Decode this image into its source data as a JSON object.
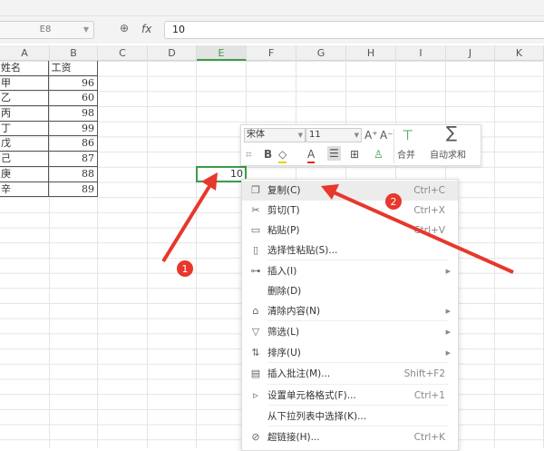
{
  "formula_bar": {
    "name_box": "E8",
    "fx_label": "fx",
    "value": "10"
  },
  "columns": [
    "A",
    "B",
    "C",
    "D",
    "E",
    "F",
    "G",
    "H",
    "I",
    "J",
    "K"
  ],
  "selected_column": "E",
  "table": {
    "headers": [
      "姓名",
      "工资"
    ],
    "rows": [
      [
        "甲",
        "96"
      ],
      [
        "乙",
        "60"
      ],
      [
        "丙",
        "98"
      ],
      [
        "丁",
        "99"
      ],
      [
        "戊",
        "86"
      ],
      [
        "己",
        "87"
      ],
      [
        "庚",
        "88"
      ],
      [
        "辛",
        "89"
      ]
    ]
  },
  "active_cell_value": "10",
  "mini_toolbar": {
    "font": "宋体",
    "size": "11",
    "bold": "B",
    "font_color": "A",
    "merge": "合并",
    "autosum": "自动求和"
  },
  "context_menu": [
    {
      "label": "复制(C)",
      "shortcut": "Ctrl+C",
      "icon": "copy-icon"
    },
    {
      "label": "剪切(T)",
      "shortcut": "Ctrl+X",
      "icon": "scissors-icon"
    },
    {
      "label": "粘贴(P)",
      "shortcut": "Ctrl+V",
      "icon": "paste-icon"
    },
    {
      "label": "选择性粘贴(S)...",
      "shortcut": "",
      "icon": "paste-special-icon"
    },
    {
      "label": "插入(I)",
      "shortcut": "",
      "icon": "insert-icon"
    },
    {
      "label": "删除(D)",
      "shortcut": "",
      "icon": ""
    },
    {
      "label": "清除内容(N)",
      "shortcut": "",
      "icon": "eraser-icon"
    },
    {
      "label": "筛选(L)",
      "shortcut": "",
      "icon": "filter-icon"
    },
    {
      "label": "排序(U)",
      "shortcut": "",
      "icon": "sort-icon"
    },
    {
      "label": "插入批注(M)...",
      "shortcut": "Shift+F2",
      "icon": "comment-icon"
    },
    {
      "label": "设置单元格格式(F)...",
      "shortcut": "Ctrl+1",
      "icon": "format-cells-icon"
    },
    {
      "label": "从下拉列表中选择(K)...",
      "shortcut": "",
      "icon": ""
    },
    {
      "label": "超链接(H)...",
      "shortcut": "Ctrl+K",
      "icon": "link-icon"
    }
  ],
  "annotations": {
    "step1": "1",
    "step2": "2",
    "color": "#e8372c"
  }
}
